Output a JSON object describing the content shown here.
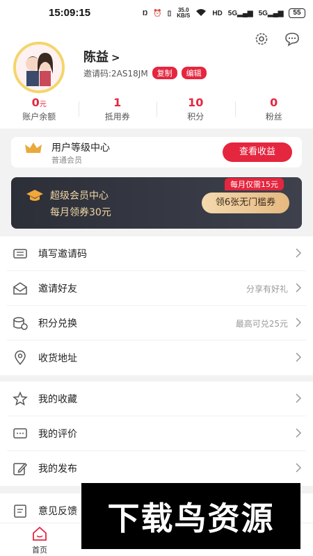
{
  "status_bar": {
    "time": "15:09:15",
    "net_speed_top": "35.0",
    "net_speed_bottom": "KB/S",
    "hd": "HD",
    "signal1": "5G",
    "signal2": "5G",
    "battery": "55"
  },
  "profile": {
    "name": "陈益",
    "name_arrow": ">",
    "invite_code": "邀请码:2AS18JM",
    "copy_label": "复制",
    "edit_label": "编辑"
  },
  "stats": [
    {
      "value": "0",
      "unit": "元",
      "label": "账户余额"
    },
    {
      "value": "1",
      "unit": "",
      "label": "抵用券"
    },
    {
      "value": "10",
      "unit": "",
      "label": "积分"
    },
    {
      "value": "0",
      "unit": "",
      "label": "粉丝"
    }
  ],
  "level_card": {
    "title": "用户等级中心",
    "subtitle": "普通会员",
    "button": "查看收益"
  },
  "vip_card": {
    "title": "超级会员中心",
    "subtitle": "每月领券30元",
    "badge": "每月仅需15元",
    "button": "领6张无门槛券"
  },
  "menu_group1": [
    {
      "label": "填写邀请码",
      "extra": ""
    },
    {
      "label": "邀请好友",
      "extra": "分享有好礼"
    },
    {
      "label": "积分兑换",
      "extra": "最高可兑25元"
    },
    {
      "label": "收货地址",
      "extra": ""
    }
  ],
  "menu_group2": [
    {
      "label": "我的收藏",
      "extra": ""
    },
    {
      "label": "我的评价",
      "extra": ""
    },
    {
      "label": "我的发布",
      "extra": ""
    }
  ],
  "menu_group3": [
    {
      "label": "意见反馈",
      "extra": ""
    }
  ],
  "tabbar": {
    "home": "首页"
  },
  "watermark": "下载鸟资源",
  "colors": {
    "accent": "#e5263f",
    "vip_gold": "#f2d7a6"
  }
}
